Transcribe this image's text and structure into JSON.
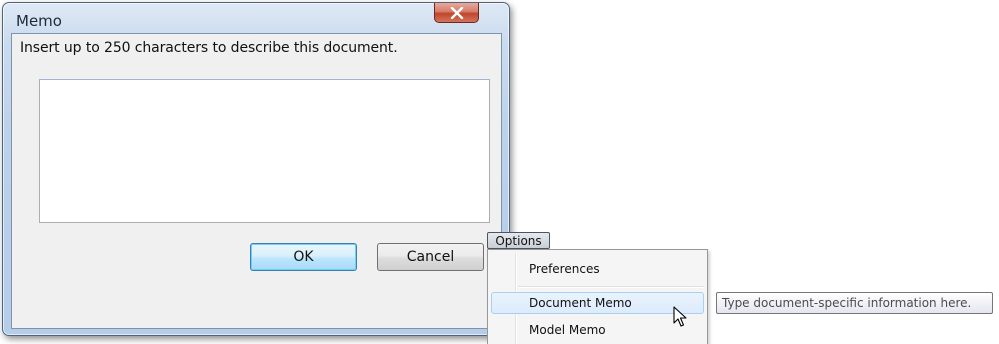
{
  "dialog": {
    "title": "Memo",
    "prompt": "Insert up to 250 characters to describe this document.",
    "memo_value": "",
    "ok_label": "OK",
    "cancel_label": "Cancel",
    "close_icon": "close-x-icon"
  },
  "options": {
    "button_label": "Options",
    "menu_items": [
      {
        "label": "Preferences"
      },
      {
        "label": "Document Memo",
        "hovered": true
      },
      {
        "label": "Model Memo"
      }
    ]
  },
  "tooltip": {
    "text": "Type document-specific information here."
  },
  "colors": {
    "close_button": "#c7462c",
    "menu_highlight": "#dcebfc",
    "default_button_border": "#3c7fb1"
  }
}
